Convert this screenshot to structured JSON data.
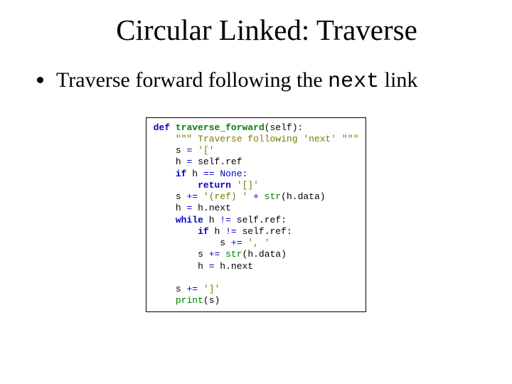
{
  "title": "Circular Linked: Traverse",
  "bullet": {
    "pre": "Traverse forward following the ",
    "code": "next",
    "post": " link"
  },
  "code": {
    "l01_def": "def",
    "l01_fn": "traverse_forward",
    "l01_rest": "(self):",
    "l02_doc": "\"\"\" Traverse following 'next' \"\"\"",
    "l03_a": "s ",
    "l03_eq": "=",
    "l03_b": " ",
    "l03_str": "'['",
    "l04_a": "h ",
    "l04_eq": "=",
    "l04_b": " self.ref",
    "l05_if": "if",
    "l05_a": " h ",
    "l05_eqeq": "==",
    "l05_b": " ",
    "l05_none": "None",
    "l05_c": ":",
    "l06_ret": "return",
    "l06_sp": " ",
    "l06_str": "'[]'",
    "l07_a": "s ",
    "l07_pluseq": "+=",
    "l07_b": " ",
    "l07_str": "'(ref) '",
    "l07_c": " ",
    "l07_plus": "+",
    "l07_d": " ",
    "l07_strfn": "str",
    "l07_e": "(h.data)",
    "l08_a": "h ",
    "l08_eq": "=",
    "l08_b": " h.next",
    "l09_while": "while",
    "l09_a": " h ",
    "l09_neq": "!=",
    "l09_b": " self.ref:",
    "l10_if": "if",
    "l10_a": " h ",
    "l10_neq": "!=",
    "l10_b": " self.ref:",
    "l11_a": "s ",
    "l11_pluseq": "+=",
    "l11_b": " ",
    "l11_str": "', '",
    "l12_a": "s ",
    "l12_pluseq": "+=",
    "l12_b": " ",
    "l12_strfn": "str",
    "l12_c": "(h.data)",
    "l13_a": "h ",
    "l13_eq": "=",
    "l13_b": " h.next",
    "l14_blank": "",
    "l15_a": "s ",
    "l15_pluseq": "+=",
    "l15_b": " ",
    "l15_str": "']'",
    "l16_print": "print",
    "l16_a": "(s)"
  }
}
